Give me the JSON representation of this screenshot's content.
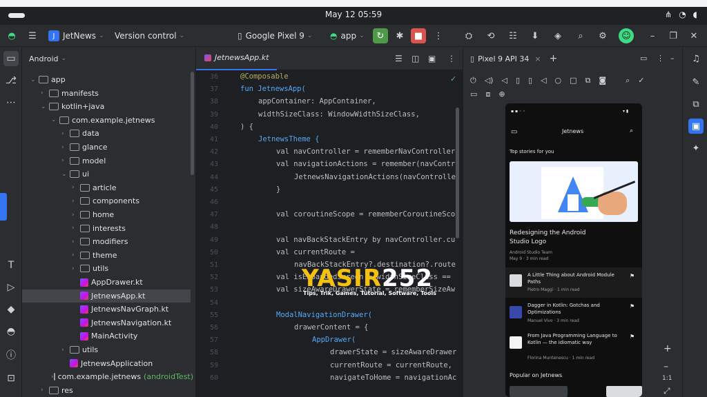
{
  "os": {
    "clock": "May 12  05:59"
  },
  "toolbar": {
    "project_badge": "J",
    "project_name": "JetNews",
    "vcs": "Version control",
    "device": "Google Pixel 9",
    "run_config": "app"
  },
  "project_panel": {
    "view": "Android",
    "items": [
      {
        "label": "app",
        "indent": 0,
        "arrow": "⌄",
        "kind": "folder"
      },
      {
        "label": "manifests",
        "indent": 1,
        "arrow": "›",
        "kind": "folder"
      },
      {
        "label": "kotlin+java",
        "indent": 1,
        "arrow": "⌄",
        "kind": "folder"
      },
      {
        "label": "com.example.jetnews",
        "indent": 2,
        "arrow": "⌄",
        "kind": "folder"
      },
      {
        "label": "data",
        "indent": 3,
        "arrow": "›",
        "kind": "folder"
      },
      {
        "label": "glance",
        "indent": 3,
        "arrow": "›",
        "kind": "folder"
      },
      {
        "label": "model",
        "indent": 3,
        "arrow": "›",
        "kind": "folder"
      },
      {
        "label": "ui",
        "indent": 3,
        "arrow": "⌄",
        "kind": "folder"
      },
      {
        "label": "article",
        "indent": 4,
        "arrow": "›",
        "kind": "folder"
      },
      {
        "label": "components",
        "indent": 4,
        "arrow": "›",
        "kind": "folder"
      },
      {
        "label": "home",
        "indent": 4,
        "arrow": "›",
        "kind": "folder"
      },
      {
        "label": "interests",
        "indent": 4,
        "arrow": "›",
        "kind": "folder"
      },
      {
        "label": "modifiers",
        "indent": 4,
        "arrow": "›",
        "kind": "folder"
      },
      {
        "label": "theme",
        "indent": 4,
        "arrow": "›",
        "kind": "folder"
      },
      {
        "label": "utils",
        "indent": 4,
        "arrow": "›",
        "kind": "folder"
      },
      {
        "label": "AppDrawer.kt",
        "indent": 4,
        "arrow": "",
        "kind": "kt"
      },
      {
        "label": "JetnewsApp.kt",
        "indent": 4,
        "arrow": "",
        "kind": "kt",
        "selected": true
      },
      {
        "label": "JetnewsNavGraph.kt",
        "indent": 4,
        "arrow": "",
        "kind": "kt"
      },
      {
        "label": "JetnewsNavigation.kt",
        "indent": 4,
        "arrow": "",
        "kind": "kt"
      },
      {
        "label": "MainActivity",
        "indent": 4,
        "arrow": "",
        "kind": "kt"
      },
      {
        "label": "utils",
        "indent": 3,
        "arrow": "›",
        "kind": "folder"
      },
      {
        "label": "JetnewsApplication",
        "indent": 3,
        "arrow": "",
        "kind": "kt"
      },
      {
        "label": "com.example.jetnews",
        "indent": 2,
        "arrow": "›",
        "kind": "folder",
        "suffix": "(androidTest)"
      },
      {
        "label": "res",
        "indent": 1,
        "arrow": "›",
        "kind": "folder"
      }
    ]
  },
  "editor": {
    "tab": "JetnewsApp.kt",
    "lines": [
      {
        "n": "36",
        "t": "@Composable",
        "c": "an",
        "i": 0
      },
      {
        "n": "37",
        "t": "fun JetnewsApp(",
        "c": "fn",
        "i": 0
      },
      {
        "n": "38",
        "t": "appContainer: AppContainer,",
        "c": "pl",
        "i": 1
      },
      {
        "n": "39",
        "t": "widthSizeClass: WindowWidthSizeClass,",
        "c": "pl",
        "i": 1
      },
      {
        "n": "40",
        "t": ") {",
        "c": "pl",
        "i": 0
      },
      {
        "n": "41",
        "t": "JetnewsTheme {",
        "c": "fn",
        "i": 1
      },
      {
        "n": "42",
        "t": "val navController = rememberNavController",
        "c": "pl",
        "i": 2
      },
      {
        "n": "43",
        "t": "val navigationActions = remember(navContr",
        "c": "pl",
        "i": 2
      },
      {
        "n": "44",
        "t": "JetnewsNavigationActions(navControlle",
        "c": "pl",
        "i": 3
      },
      {
        "n": "45",
        "t": "}",
        "c": "pl",
        "i": 2
      },
      {
        "n": "46",
        "t": "",
        "c": "pl",
        "i": 0
      },
      {
        "n": "47",
        "t": "val coroutineScope = rememberCoroutineSco",
        "c": "pl",
        "i": 2
      },
      {
        "n": "48",
        "t": "",
        "c": "pl",
        "i": 0
      },
      {
        "n": "49",
        "t": "val navBackStackEntry by navController.cu",
        "c": "pl",
        "i": 2
      },
      {
        "n": "50",
        "t": "val currentRoute =",
        "c": "pl",
        "i": 2
      },
      {
        "n": "51",
        "t": "navBackStackEntry?.destination?.route",
        "c": "pl",
        "i": 3
      },
      {
        "n": "52",
        "t": "val isExpandedScreen = widthSizeClass ==",
        "c": "pl",
        "i": 2
      },
      {
        "n": "53",
        "t": "val sizeAwareDrawerState = rememberSizeAw",
        "c": "pl",
        "i": 2
      },
      {
        "n": "54",
        "t": "",
        "c": "pl",
        "i": 0
      },
      {
        "n": "55",
        "t": "ModalNavigationDrawer(",
        "c": "fn",
        "i": 2
      },
      {
        "n": "56",
        "t": "drawerContent = {",
        "c": "pl",
        "i": 3
      },
      {
        "n": "57",
        "t": "AppDrawer(",
        "c": "fn",
        "i": 4
      },
      {
        "n": "58",
        "t": "drawerState = sizeAwareDrawer",
        "c": "pl",
        "i": 5
      },
      {
        "n": "59",
        "t": "currentRoute = currentRoute,",
        "c": "pl",
        "i": 5
      },
      {
        "n": "60",
        "t": "navigateToHome = navigationAc",
        "c": "pl",
        "i": 5
      }
    ]
  },
  "device_panel": {
    "tab": "Pixel 9 API 34"
  },
  "phone": {
    "app_title": "Jetnews",
    "section_top": "Top stories for you",
    "featured_title": "Redesigning the Android Studio Logo",
    "featured_author": "Android Studio Team",
    "featured_meta": "May 9 · 3 min read",
    "list": [
      {
        "title": "A Little Thing about Android Module Paths",
        "meta": "Pietro Maggi · 1 min read"
      },
      {
        "title": "Dagger in Kotlin: Gotchas and Optimizations",
        "meta": "Manuel Vivo · 3 min read"
      },
      {
        "title": "From Java Programming Language to Kotlin — the idiomatic way",
        "meta": "Florina Muntenescu · 1 min read"
      }
    ],
    "section_popular": "Popular on Jetnews"
  },
  "watermark": {
    "brand_a": "YASIR",
    "brand_b": "252",
    "tagline": "Tips, Trik, Games, Tutorial, Software, Tools"
  }
}
